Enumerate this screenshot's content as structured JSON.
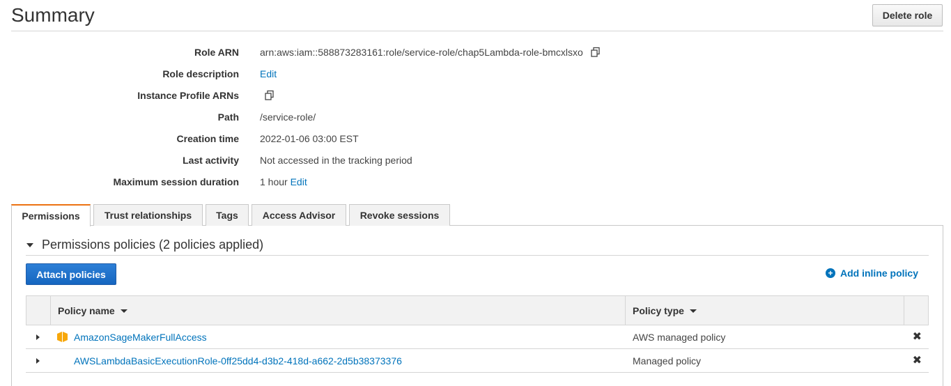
{
  "header": {
    "title": "Summary",
    "delete_label": "Delete role"
  },
  "summary": {
    "role_arn": {
      "label": "Role ARN",
      "value": "arn:aws:iam::588873283161:role/service-role/chap5Lambda-role-bmcxlsxo"
    },
    "role_description": {
      "label": "Role description",
      "edit": "Edit"
    },
    "instance_profile": {
      "label": "Instance Profile ARNs"
    },
    "path": {
      "label": "Path",
      "value": "/service-role/"
    },
    "creation_time": {
      "label": "Creation time",
      "value": "2022-01-06 03:00 EST"
    },
    "last_activity": {
      "label": "Last activity",
      "value": "Not accessed in the tracking period"
    },
    "max_session": {
      "label": "Maximum session duration",
      "value": "1 hour",
      "edit": "Edit"
    }
  },
  "tabs": [
    {
      "label": "Permissions",
      "active": true
    },
    {
      "label": "Trust relationships",
      "active": false
    },
    {
      "label": "Tags",
      "active": false
    },
    {
      "label": "Access Advisor",
      "active": false
    },
    {
      "label": "Revoke sessions",
      "active": false
    }
  ],
  "permissions": {
    "section_title": "Permissions policies (2 policies applied)",
    "attach_label": "Attach policies",
    "add_inline_label": "Add inline policy",
    "columns": {
      "name": "Policy name",
      "type": "Policy type"
    },
    "rows": [
      {
        "name": "AmazonSageMakerFullAccess",
        "type": "AWS managed policy",
        "icon": "aws-managed-cube-icon"
      },
      {
        "name": "AWSLambdaBasicExecutionRole-0ff25dd4-d3b2-418d-a662-2d5b38373376",
        "type": "Managed policy",
        "icon": ""
      }
    ]
  },
  "colors": {
    "accent_tab": "#ec7211",
    "link": "#0073bb",
    "primary_button": "#1566c0",
    "aws_icon": "#f90"
  }
}
